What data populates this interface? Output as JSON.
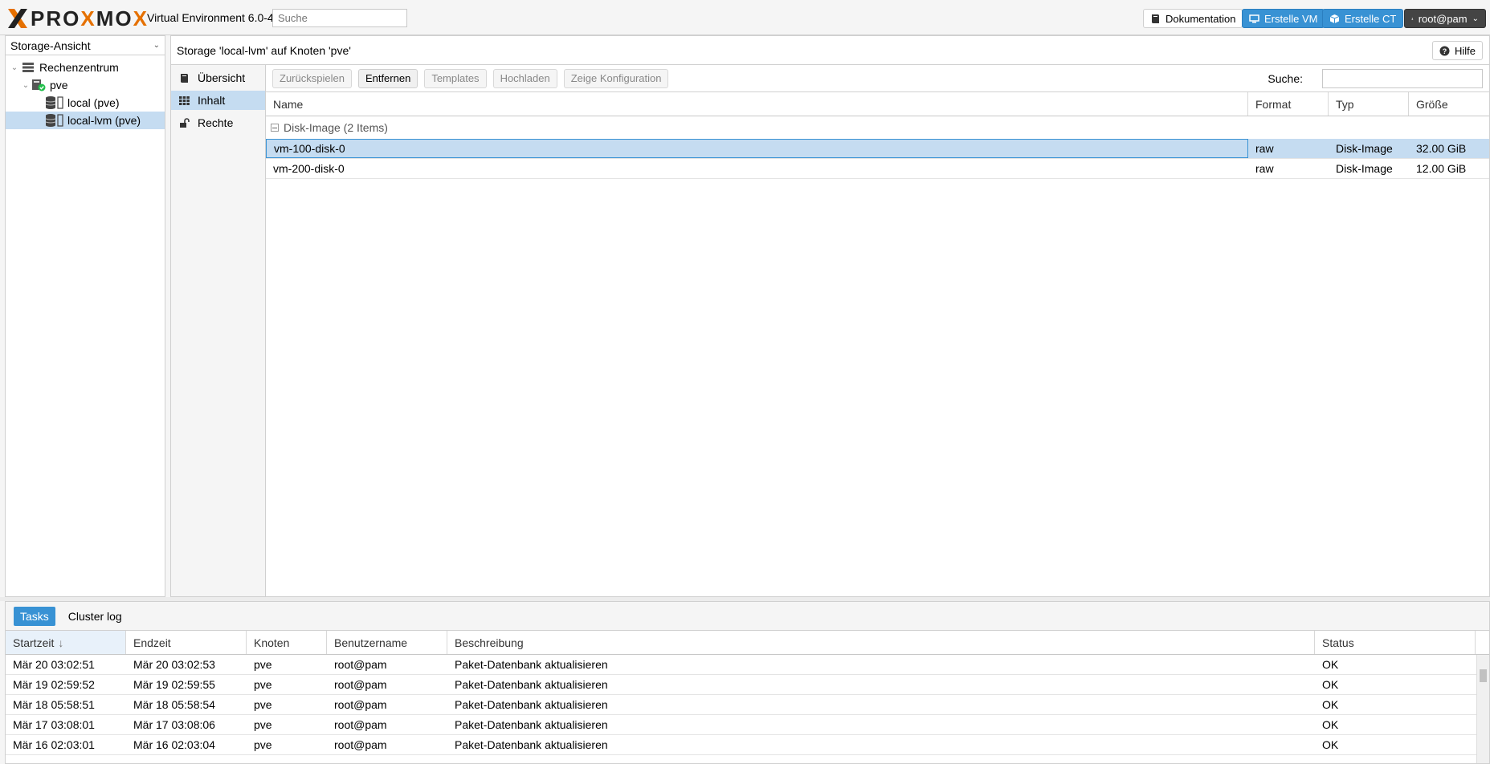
{
  "header": {
    "brand_left": "PRO",
    "brand_o1": "X",
    "brand_right": "MO",
    "brand_end": "X",
    "version": "Virtual Environment 6.0-4",
    "search_placeholder": "Suche",
    "docs_label": "Dokumentation",
    "create_vm_label": "Erstelle VM",
    "create_ct_label": "Erstelle CT",
    "user_label": "root@pam"
  },
  "sidebar": {
    "view_select": "Storage-Ansicht",
    "tree": [
      {
        "label": "Rechenzentrum"
      },
      {
        "label": "pve"
      },
      {
        "label": "local (pve)"
      },
      {
        "label": "local-lvm (pve)"
      }
    ]
  },
  "main": {
    "title": "Storage 'local-lvm' auf Knoten 'pve'",
    "help_label": "Hilfe",
    "subnav": [
      {
        "label": "Übersicht"
      },
      {
        "label": "Inhalt"
      },
      {
        "label": "Rechte"
      }
    ],
    "toolbar": {
      "restore": "Zurückspielen",
      "remove": "Entfernen",
      "templates": "Templates",
      "upload": "Hochladen",
      "show_config": "Zeige Konfiguration",
      "search_label": "Suche:"
    },
    "columns": [
      "Name",
      "Format",
      "Typ",
      "Größe"
    ],
    "group_label": "Disk-Image (2 Items)",
    "rows": [
      {
        "name": "vm-100-disk-0",
        "format": "raw",
        "type": "Disk-Image",
        "size": "32.00 GiB"
      },
      {
        "name": "vm-200-disk-0",
        "format": "raw",
        "type": "Disk-Image",
        "size": "12.00 GiB"
      }
    ]
  },
  "bottom": {
    "tabs": [
      "Tasks",
      "Cluster log"
    ],
    "columns": [
      "Startzeit",
      "Endzeit",
      "Knoten",
      "Benutzername",
      "Beschreibung",
      "Status"
    ],
    "rows": [
      {
        "start": "Mär 20 03:02:51",
        "end": "Mär 20 03:02:53",
        "node": "pve",
        "user": "root@pam",
        "desc": "Paket-Datenbank aktualisieren",
        "status": "OK"
      },
      {
        "start": "Mär 19 02:59:52",
        "end": "Mär 19 02:59:55",
        "node": "pve",
        "user": "root@pam",
        "desc": "Paket-Datenbank aktualisieren",
        "status": "OK"
      },
      {
        "start": "Mär 18 05:58:51",
        "end": "Mär 18 05:58:54",
        "node": "pve",
        "user": "root@pam",
        "desc": "Paket-Datenbank aktualisieren",
        "status": "OK"
      },
      {
        "start": "Mär 17 03:08:01",
        "end": "Mär 17 03:08:06",
        "node": "pve",
        "user": "root@pam",
        "desc": "Paket-Datenbank aktualisieren",
        "status": "OK"
      },
      {
        "start": "Mär 16 02:03:01",
        "end": "Mär 16 02:03:04",
        "node": "pve",
        "user": "root@pam",
        "desc": "Paket-Datenbank aktualisieren",
        "status": "OK"
      }
    ]
  },
  "colors": {
    "accent": "#3892d4",
    "selection": "#c5dcf1",
    "brand_orange": "#e57000",
    "ok_green": "#21bf4b"
  }
}
